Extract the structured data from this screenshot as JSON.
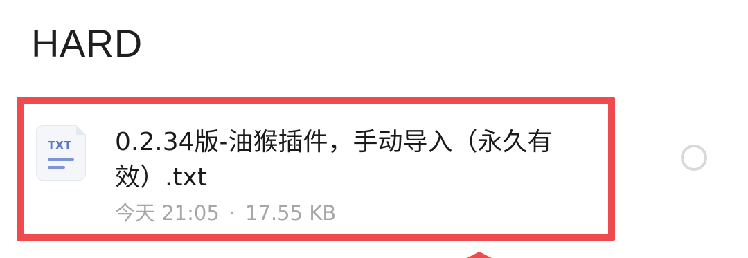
{
  "section": {
    "title": "HARD"
  },
  "file": {
    "icon_type": "txt-file-icon",
    "extension_label": "TXT",
    "name": "0.2.34版-油猴插件，手动导入（永久有效）.txt",
    "date": "今天 21:05",
    "separator": "·",
    "size": "17.55 KB",
    "selected": false
  },
  "annotation": {
    "highlight_color": "#ef4a4d"
  },
  "colors": {
    "title_text": "#1f1f1f",
    "meta_text": "#a6a6a6",
    "icon_accent": "#5b78c8"
  }
}
